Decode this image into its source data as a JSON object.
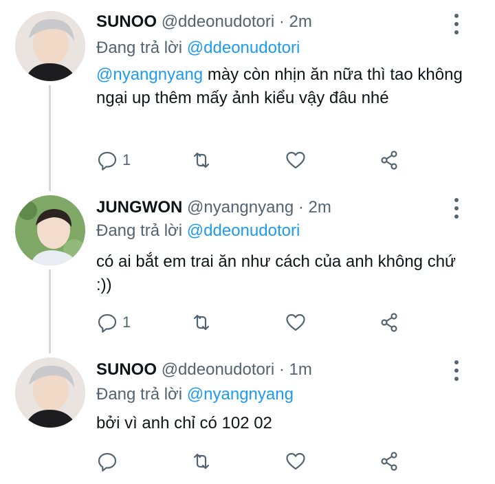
{
  "tweets": [
    {
      "name": "SUNOO",
      "handle": "@ddeonudotori",
      "time": "2m",
      "reply_prefix": "Đang trả lời",
      "reply_to": "@ddeonudotori",
      "mention": "@nyangnyang",
      "text": " mày còn nhịn ăn nữa thì tao không ngại up thêm mấy ảnh kiểu vậy đâu nhé",
      "reply_count": "1"
    },
    {
      "name": "JUNGWON",
      "handle": "@nyangnyang",
      "time": "2m",
      "reply_prefix": "Đang trả lời",
      "reply_to": "@ddeonudotori",
      "mention": "",
      "text": "có ai bắt em trai ăn như cách của anh không chứ :))",
      "reply_count": "1"
    },
    {
      "name": "SUNOO",
      "handle": "@ddeonudotori",
      "time": "1m",
      "reply_prefix": "Đang trả lời",
      "reply_to": "@nyangnyang",
      "mention": "",
      "text": "bởi vì anh chỉ có 102 02",
      "reply_count": ""
    }
  ],
  "separator": "·",
  "icons": {
    "reply": "reply-icon",
    "retweet": "retweet-icon",
    "like": "heart-icon",
    "share": "share-icon",
    "more": "more-vertical-icon"
  },
  "colors": {
    "link": "#1d9bf0",
    "muted": "#536471",
    "text": "#0f1419",
    "thread_line": "#cfd9de"
  }
}
